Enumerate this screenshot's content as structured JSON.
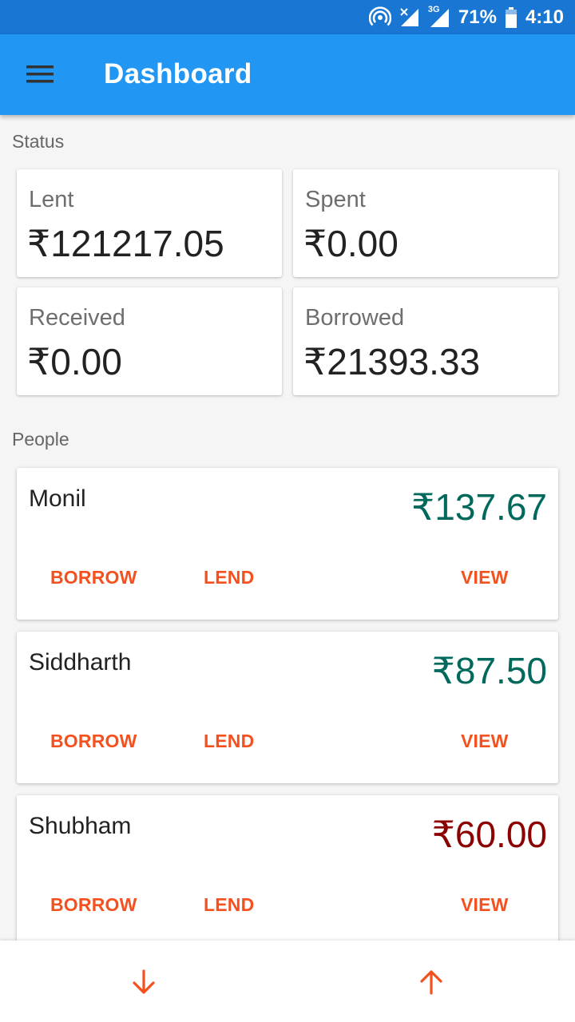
{
  "status_bar": {
    "battery": "71%",
    "time": "4:10",
    "network": "3G"
  },
  "app_bar": {
    "title": "Dashboard",
    "menu_icon": "hamburger-menu-icon"
  },
  "status_section": {
    "label": "Status",
    "cards": [
      {
        "label": "Lent",
        "value": "₹121217.05"
      },
      {
        "label": "Spent",
        "value": "₹0.00"
      },
      {
        "label": "Received",
        "value": "₹0.00"
      },
      {
        "label": "Borrowed",
        "value": "₹21393.33"
      }
    ]
  },
  "people_section": {
    "label": "People",
    "people": [
      {
        "name": "Monil",
        "amount": "₹137.67",
        "amount_color": "#00695c",
        "borrow": "BORROW",
        "lend": "LEND",
        "view": "VIEW"
      },
      {
        "name": "Siddharth",
        "amount": "₹87.50",
        "amount_color": "#00695c",
        "borrow": "BORROW",
        "lend": "LEND",
        "view": "VIEW"
      },
      {
        "name": "Shubham",
        "amount": "₹60.00",
        "amount_color": "#8b0000",
        "borrow": "BORROW",
        "lend": "LEND",
        "view": "VIEW"
      }
    ]
  },
  "bottom_bar": {
    "left_icon": "arrow-down-icon",
    "right_icon": "arrow-up-icon",
    "accent": "#f4511e"
  }
}
